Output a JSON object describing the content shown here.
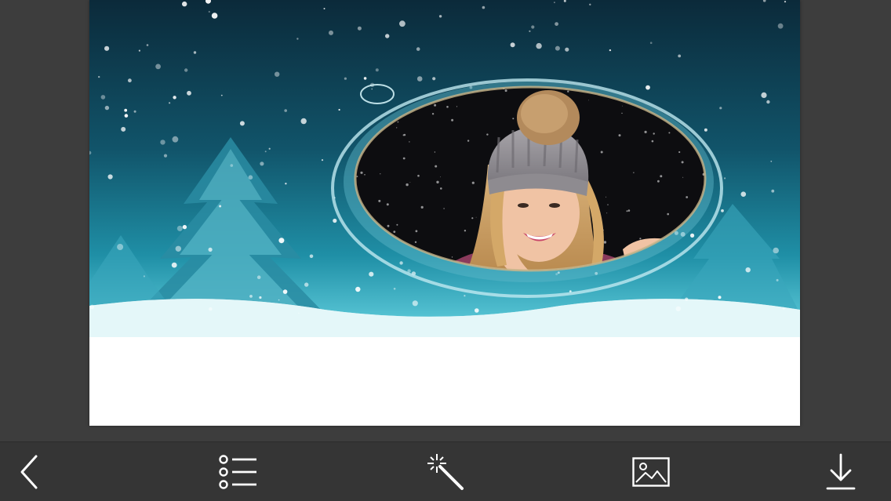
{
  "editor": {
    "frame_theme": "winter-snow-ornament",
    "colors": {
      "toolbar_bg": "#353535",
      "workspace_bg": "#3d3d3d",
      "icon": "#ffffff",
      "sky_top": "#0b2a3a",
      "sky_mid": "#1f8fa6",
      "snow_ground": "#ffffff"
    }
  },
  "toolbar": {
    "items": [
      {
        "id": "back",
        "icon": "chevron-left-icon"
      },
      {
        "id": "frames",
        "icon": "list-icon"
      },
      {
        "id": "effects",
        "icon": "magic-wand-icon"
      },
      {
        "id": "gallery",
        "icon": "image-icon"
      },
      {
        "id": "save",
        "icon": "download-icon"
      }
    ]
  }
}
